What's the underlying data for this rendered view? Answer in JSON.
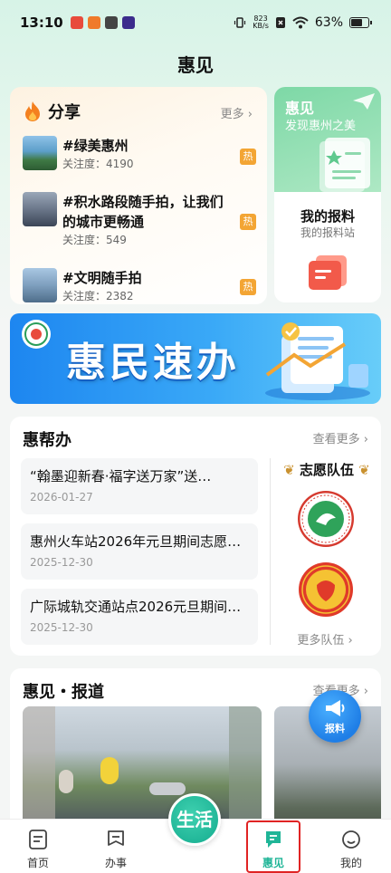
{
  "status_bar": {
    "time": "13:10",
    "net_speed_top": "823",
    "net_speed_bottom": "KB/s",
    "battery": "63%"
  },
  "page_title": "惠见",
  "share": {
    "title": "分享",
    "more": "更多",
    "topics": [
      {
        "title": "#绿美惠州",
        "attention": "关注度：4190",
        "tag": "热"
      },
      {
        "title": "#积水路段随手拍，让我们的城市更畅通",
        "attention": "关注度：549",
        "tag": "热"
      },
      {
        "title": "#文明随手拍",
        "attention": "关注度：2382",
        "tag": "热"
      }
    ]
  },
  "report_card": {
    "brand": "惠见",
    "slogan": "发现惠州之美",
    "my_report": "我的报料",
    "my_report_sub": "我的报料站"
  },
  "banner": {
    "text": "惠民速办"
  },
  "help": {
    "title": "惠帮办",
    "more": "查看更多",
    "news": [
      {
        "title": "“翰墨迎新春·福字送万家”送…",
        "date": "2026-01-27"
      },
      {
        "title": "惠州火车站2026年元旦期间志愿…",
        "date": "2025-12-30"
      },
      {
        "title": "广际城轨交通站点2026元旦期间…",
        "date": "2025-12-30"
      }
    ],
    "volunteer_title": "志愿队伍",
    "volunteer_more": "更多队伍"
  },
  "reports": {
    "title": "惠见・报道",
    "more": "查看更多"
  },
  "fab": {
    "label": "报料"
  },
  "nav": {
    "home": "首页",
    "affairs": "办事",
    "life": "生活",
    "huijian": "惠见",
    "mine": "我的"
  },
  "colors": {
    "accent_green": "#1fb597",
    "hot_tag": "#f3a534",
    "banner_blue": "#1d86f0",
    "active_highlight": "#e02424"
  }
}
